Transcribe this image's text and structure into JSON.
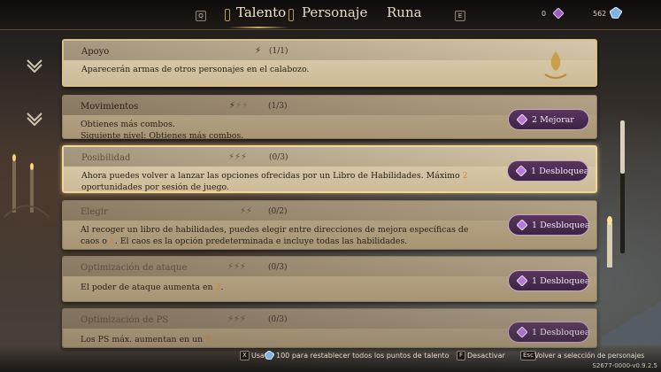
{
  "topbar": {
    "left_key": "Q",
    "right_key": "E",
    "tabs": [
      {
        "label": "Talento",
        "active": true
      },
      {
        "label": "Personaje",
        "active": false
      },
      {
        "label": "Runa",
        "active": false
      }
    ],
    "currency": [
      {
        "value": "0",
        "icon": "purple-shard-icon"
      },
      {
        "value": "562",
        "icon": "blue-crystal-icon"
      }
    ]
  },
  "talents": [
    {
      "title": "Apoyo",
      "count": "(1/1)",
      "filled_pips": 1,
      "total_pips": 1,
      "desc_lines": [
        "Aparecerán armas de otros personajes en el calabozo."
      ],
      "unlocked": true,
      "state": "maxed",
      "icon": "golden-flame-icon"
    },
    {
      "title": "Movimientos",
      "count": "(1/3)",
      "filled_pips": 1,
      "total_pips": 3,
      "desc_lines": [
        "Obtienes más combos.",
        "Siguiente nivel: Obtienes más combos."
      ],
      "unlocked": true,
      "button": "2 Mejorar"
    },
    {
      "title": "Posibilidad",
      "count": "(0/3)",
      "filled_pips": 0,
      "total_pips": 3,
      "desc_pre": "Ahora puedes volver a lanzar las opciones ofrecidas por un Libro de Habilidades. Máximo ",
      "desc_hl": "2",
      "desc_post": " oportunidades por sesión de juego.",
      "selected": true,
      "button": "1 Desbloquear"
    },
    {
      "title": "Elegir",
      "count": "(0/2)",
      "filled_pips": 0,
      "total_pips": 2,
      "desc_pre": "Al recoger un libro de habilidades, puedes elegir entre direcciones de mejora específicas de caos o ",
      "desc_hl": "1",
      "desc_post": ". El caos es la opción predeterminada e incluye todas las habilidades.",
      "button": "1 Desbloquear"
    },
    {
      "title": "Optimización de ataque",
      "count": "(0/3)",
      "filled_pips": 0,
      "total_pips": 3,
      "desc_pre": "El poder de ataque aumenta en ",
      "desc_hl": "2",
      "desc_post": ".",
      "button": "1 Desbloquear"
    },
    {
      "title": "Optimización de PS",
      "count": "(0/3)",
      "filled_pips": 0,
      "total_pips": 3,
      "desc_pre": "Los PS máx. aumentan en un ",
      "desc_hl": "8",
      "desc_post": "",
      "button": "1 Desbloquear"
    }
  ],
  "footer": {
    "reset_key": "X",
    "reset_prefix": "Usa",
    "reset_text": "100 para restablecer todos los puntos de talento",
    "deactivate_key": "F",
    "deactivate_text": "Desactivar",
    "back_key": "Esc",
    "back_text": "Volver a selección de personajes",
    "version": "S2677-0000-v0.9.2.5"
  },
  "colors": {
    "accent_gold": "#c9a866",
    "button_purple": "#5b3560",
    "highlight_orange": "#d2892e"
  }
}
